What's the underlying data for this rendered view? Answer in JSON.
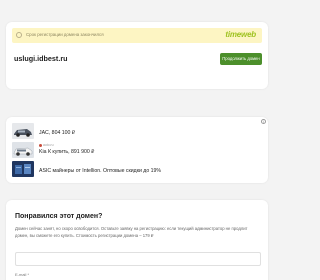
{
  "domain_card": {
    "notice": "Срок регистрации домена закончился",
    "registrar_logo": "timeweb",
    "domain_name": "uslugi.idbest.ru",
    "buy_button_label": "Продолжить домен"
  },
  "ads": {
    "info_label": "i",
    "items": [
      {
        "source": "",
        "title": "JAC, 804 100 ₽",
        "thumb_color": "#7d8795"
      },
      {
        "source": "auto.ru",
        "title": "Kia К купить, 891 900 ₽",
        "thumb_color": "#c7cdd4"
      },
      {
        "source": "",
        "title": "ASIC майнеры от Intellion. Оптовые скидки до 19%",
        "thumb_color": "#2b4a7a"
      }
    ]
  },
  "like_card": {
    "title": "Понравился этот домен?",
    "description": "Домен сейчас занят, но скоро освободится. Оставьте заявку на регистрацию: если текущий администратор не продлит домен, вы сможете его купить. Стоимость регистрации домена – 179 ₽",
    "email_label": "E-mail *"
  }
}
